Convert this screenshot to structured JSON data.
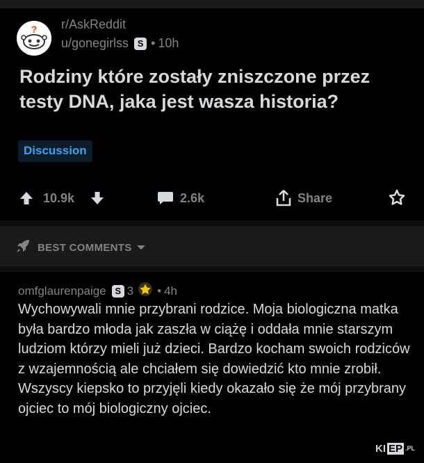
{
  "post": {
    "subreddit": "r/AskReddit",
    "author": "u/gonegirlss",
    "author_badge": "S",
    "time": "10h",
    "title": "Rodziny które zostały zniszczone przez testy DNA, jaka jest wasza historia?",
    "flair": "Discussion",
    "upvotes": "10.9k",
    "comments_count": "2.6k",
    "share_label": "Share"
  },
  "sort": {
    "label": "BEST COMMENTS"
  },
  "comment": {
    "author": "omfglaurenpaige",
    "badge": "S",
    "award_count": "3",
    "time": "4h",
    "body": "Wychowywali mnie przybrani rodzice. Moja biologiczna matka była bardzo młoda jak zaszła w ciążę i oddała mnie starszym ludziom którzy mieli już dzieci. Bardzo kocham swoich rodziców z wzajemnością ale chciałem się dowiedzić kto mnie zrobił. Wszyscy kiepsko to przyjęli kiedy okazało się że mój przybrany ojciec to mój biologiczny ojciec."
  },
  "watermark": {
    "k": "K",
    "i": "I",
    "ep": "EP",
    "pl": ".PL"
  },
  "icons": {
    "avatar": "askreddit-snoo-icon",
    "upvote": "upvote-arrow-icon",
    "downvote": "downvote-arrow-icon",
    "comment": "comment-bubble-icon",
    "share": "share-icon",
    "award": "award-icon",
    "sort": "rocket-icon",
    "chevron": "chevron-down-icon"
  },
  "colors": {
    "background": "#000000",
    "text": "#d7dadc",
    "meta": "#818384",
    "flair_text": "#3aa3ef",
    "flair_bg": "#0b1c2b",
    "bar_bg": "#1a1a1b",
    "award_gold": "#f5c518"
  }
}
